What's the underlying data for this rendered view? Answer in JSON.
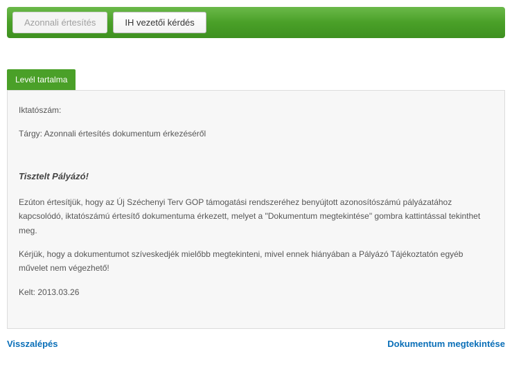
{
  "toolbar": {
    "notify_label": "Azonnali értesítés",
    "ih_question_label": "IH vezetői kérdés"
  },
  "tab": {
    "letter_content_label": "Levél tartalma"
  },
  "letter": {
    "iktato_label": "Iktatószám:",
    "targy_line": "Tárgy: Azonnali értesítés dokumentum érkezéséről",
    "salutation": "Tisztelt Pályázó!",
    "paragraph1": "Ezúton értesítjük, hogy az Új Széchenyi Terv GOP támogatási rendszeréhez benyújtott azonosítószámú pályázatához kapcsolódó,                                           iktatószámú értesítő dokumentuma érkezett, melyet a \"Dokumentum megtekintése\" gombra kattintással tekinthet meg.",
    "paragraph2": "Kérjük, hogy a dokumentumot szíveskedjék mielőbb megtekinteni, mivel ennek hiányában a Pályázó Tájékoztatón egyéb művelet nem végezhető!",
    "kelt_line": "Kelt: 2013.03.26"
  },
  "footer": {
    "back_label": "Visszalépés",
    "view_doc_label": "Dokumentum megtekintése"
  }
}
